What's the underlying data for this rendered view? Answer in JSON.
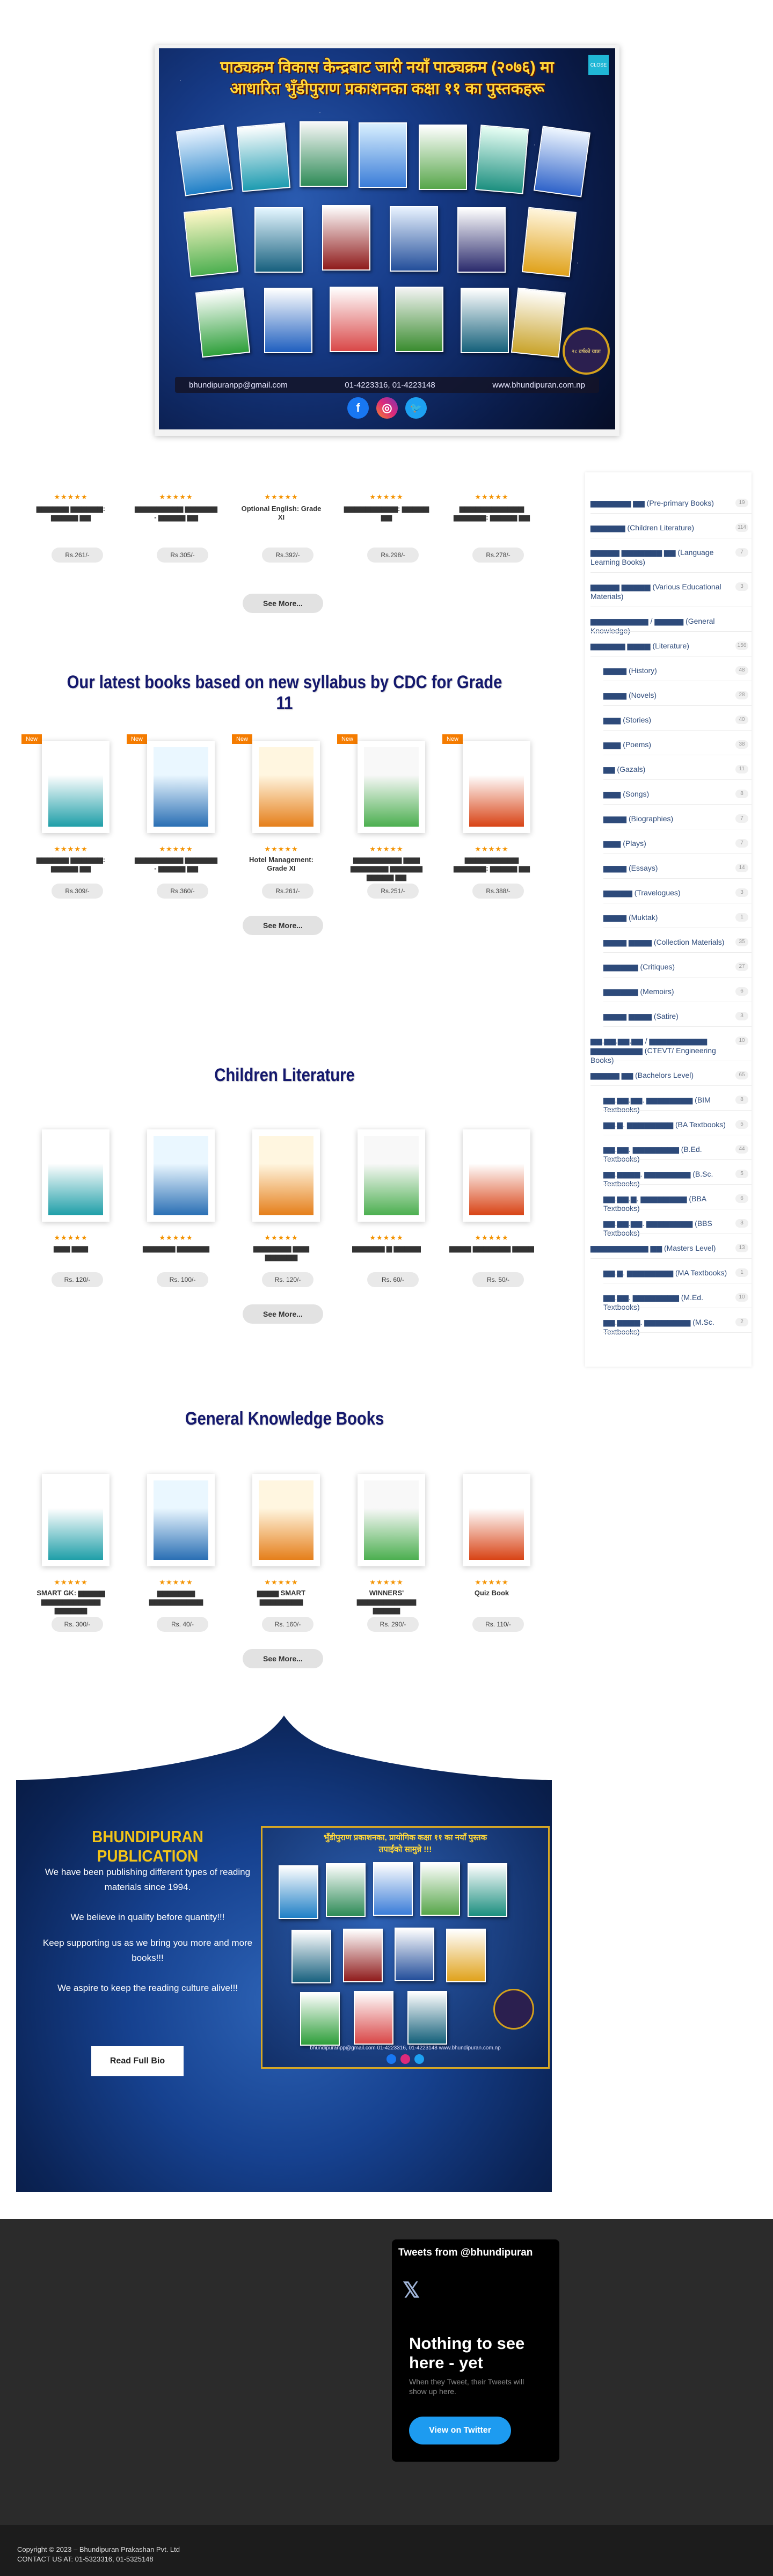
{
  "banner": {
    "title_line1": "पाठ्यक्रम विकास केन्द्रबाट जारी नयाँ पाठ्यक्रम (२०७६) मा",
    "title_line2": "आधारित भुँडीपुराण प्रकाशनका कक्षा ११ का पुस्तकहरू",
    "close_label": "CLOSE",
    "email": "bhundipuranpp@gmail.com",
    "phone": "01-4223316, 01-4223148",
    "website": "www.bhundipuran.com.np",
    "badge_text": "२८ वर्षको यात्रा",
    "social": [
      "f",
      "◎",
      "🐦"
    ]
  },
  "grid_row1": {
    "items": [
      {
        "title": "▆▆▆▆▆▆ ▆▆▆▆▆▆: ▆▆▆▆▆ ▆▆",
        "price": "Rs.261/-"
      },
      {
        "title": "▆▆▆▆▆▆▆▆▆ ▆▆▆▆▆▆ - ▆▆▆▆▆ ▆▆",
        "price": "Rs.305/-"
      },
      {
        "title": "Optional English: Grade XI",
        "price": "Rs.392/-"
      },
      {
        "title": "▆▆▆▆▆▆▆▆▆▆: ▆▆▆▆▆ ▆▆",
        "price": "Rs.298/-"
      },
      {
        "title": "▆▆▆▆▆▆▆▆▆▆▆▆ ▆▆▆▆▆▆: ▆▆▆▆▆ ▆▆",
        "price": "Rs.278/-"
      }
    ],
    "see_more": "See More..."
  },
  "section_grade11": {
    "title": "Our latest books based on new syllabus by CDC for Grade 11",
    "new_label": "New",
    "items": [
      {
        "title": "▆▆▆▆▆▆ ▆▆▆▆▆▆: ▆▆▆▆▆ ▆▆",
        "price": "Rs.309/-"
      },
      {
        "title": "▆▆▆▆▆▆▆▆▆ ▆▆▆▆▆▆ - ▆▆▆▆▆ ▆▆",
        "price": "Rs.360/-"
      },
      {
        "title": "Hotel Management: Grade XI",
        "price": "Rs.261/-"
      },
      {
        "title": "▆▆▆▆▆▆▆▆▆ ▆▆▆ ▆▆▆▆▆▆▆ ▆▆▆▆▆▆ ▆▆▆▆▆ ▆▆",
        "price": "Rs.251/-"
      },
      {
        "title": "▆▆▆▆▆▆▆▆▆▆ ▆▆▆▆▆▆: ▆▆▆▆▆ ▆▆",
        "price": "Rs.388/-"
      }
    ],
    "see_more": "See More..."
  },
  "section_children": {
    "title": "Children Literature",
    "items": [
      {
        "title": "▆▆▆ ▆▆▆",
        "price": "Rs. 120/-"
      },
      {
        "title": "▆▆▆▆▆▆ ▆▆▆▆▆▆",
        "price": "Rs. 100/-"
      },
      {
        "title": "▆▆▆▆▆▆▆ ▆▆▆ ▆▆▆▆▆▆",
        "price": "Rs. 120/-"
      },
      {
        "title": "▆▆▆▆▆▆ ▆ ▆▆▆▆▆",
        "price": "Rs. 60/-"
      },
      {
        "title": "▆▆▆▆ ▆▆▆▆▆▆▆ ▆▆▆▆",
        "price": "Rs. 50/-"
      }
    ],
    "see_more": "See More..."
  },
  "section_gk": {
    "title": "General Knowledge Books",
    "items": [
      {
        "title": "SMART GK: ▆▆▆▆▆ ▆▆▆▆▆▆▆▆▆▆▆ ▆▆▆▆▆▆",
        "price": "Rs. 300/-"
      },
      {
        "title": "▆▆▆▆▆▆▆ ▆▆▆▆▆▆▆▆▆▆",
        "price": "Rs. 40/-"
      },
      {
        "title": "▆▆▆▆ SMART ▆▆▆▆▆▆▆▆",
        "price": "Rs. 160/-"
      },
      {
        "title": "WINNERS' ▆▆▆▆▆▆▆▆▆▆▆ ▆▆▆▆▆",
        "price": "Rs. 290/-"
      },
      {
        "title": "Quiz Book",
        "price": "Rs. 110/-"
      }
    ],
    "see_more": "See More..."
  },
  "sidebar": {
    "categories": [
      {
        "name": "▆▆▆▆▆▆▆ ▆▆ (Pre-primary Books)",
        "count": "19",
        "indent": 0
      },
      {
        "name": "▆▆▆▆▆▆ (Children Literature)",
        "count": "114",
        "indent": 0
      },
      {
        "name": "▆▆▆▆▆ ▆▆▆▆▆▆▆ ▆▆ (Language Learning Books)",
        "count": "7",
        "indent": 0
      },
      {
        "name": "▆▆▆▆▆ ▆▆▆▆▆ (Various Educational Materials)",
        "count": "3",
        "indent": 0
      },
      {
        "name": "▆▆▆▆▆▆▆▆▆▆ / ▆▆▆▆▆ (General Knowledge)",
        "count": "",
        "indent": 0
      },
      {
        "name": "▆▆▆▆▆▆ ▆▆▆▆ (Literature)",
        "count": "156",
        "indent": 0
      },
      {
        "name": "▆▆▆▆ (History)",
        "count": "48",
        "indent": 1
      },
      {
        "name": "▆▆▆▆ (Novels)",
        "count": "28",
        "indent": 1
      },
      {
        "name": "▆▆▆ (Stories)",
        "count": "40",
        "indent": 1
      },
      {
        "name": "▆▆▆ (Poems)",
        "count": "38",
        "indent": 1
      },
      {
        "name": "▆▆ (Gazals)",
        "count": "11",
        "indent": 1
      },
      {
        "name": "▆▆▆ (Songs)",
        "count": "8",
        "indent": 1
      },
      {
        "name": "▆▆▆▆ (Biographies)",
        "count": "7",
        "indent": 1
      },
      {
        "name": "▆▆▆ (Plays)",
        "count": "7",
        "indent": 1
      },
      {
        "name": "▆▆▆▆ (Essays)",
        "count": "14",
        "indent": 1
      },
      {
        "name": "▆▆▆▆▆ (Travelogues)",
        "count": "3",
        "indent": 1
      },
      {
        "name": "▆▆▆▆ (Muktak)",
        "count": "1",
        "indent": 1
      },
      {
        "name": "▆▆▆▆ ▆▆▆▆ (Collection Materials)",
        "count": "35",
        "indent": 1
      },
      {
        "name": "▆▆▆▆▆▆ (Critiques)",
        "count": "27",
        "indent": 1
      },
      {
        "name": "▆▆▆▆▆▆ (Memoirs)",
        "count": "6",
        "indent": 1
      },
      {
        "name": "▆▆▆▆ ▆▆▆▆ (Satire)",
        "count": "3",
        "indent": 1
      },
      {
        "name": "▆▆.▆▆.▆▆.▆▆ / ▆▆▆▆▆▆▆▆▆▆ ▆▆▆▆▆▆▆▆▆ (CTEVT/ Engineering Books)",
        "count": "10",
        "indent": 0
      },
      {
        "name": "▆▆▆▆▆ ▆▆ (Bachelors Level)",
        "count": "65",
        "indent": 0
      },
      {
        "name": "▆▆.▆▆.▆▆. ▆▆▆▆▆▆▆▆ (BIM Textbooks)",
        "count": "8",
        "indent": 1
      },
      {
        "name": "▆▆.▆. ▆▆▆▆▆▆▆▆ (BA Textbooks)",
        "count": "5",
        "indent": 1
      },
      {
        "name": "▆▆.▆▆. ▆▆▆▆▆▆▆▆ (B.Ed. Textbooks)",
        "count": "44",
        "indent": 1
      },
      {
        "name": "▆▆.▆▆▆▆. ▆▆▆▆▆▆▆▆ (B.Sc. Textbooks)",
        "count": "5",
        "indent": 1
      },
      {
        "name": "▆▆.▆▆.▆. ▆▆▆▆▆▆▆▆ (BBA Textbooks)",
        "count": "6",
        "indent": 1
      },
      {
        "name": "▆▆.▆▆.▆▆. ▆▆▆▆▆▆▆▆ (BBS Textbooks)",
        "count": "3",
        "indent": 1
      },
      {
        "name": "▆▆▆▆▆▆▆▆▆▆ ▆▆ (Masters Level)",
        "count": "13",
        "indent": 0
      },
      {
        "name": "▆▆.▆. ▆▆▆▆▆▆▆▆ (MA Textbooks)",
        "count": "1",
        "indent": 1
      },
      {
        "name": "▆▆.▆▆. ▆▆▆▆▆▆▆▆ (M.Ed. Textbooks)",
        "count": "10",
        "indent": 1
      },
      {
        "name": "▆▆.▆▆▆▆. ▆▆▆▆▆▆▆▆ (M.Sc. Textbooks)",
        "count": "2",
        "indent": 1
      }
    ]
  },
  "promo": {
    "heading": "BHUNDIPURAN PUBLICATION",
    "p1": "We have been publishing different types of reading materials since 1994.",
    "p2": "We believe in quality before quantity!!!",
    "p3": "Keep supporting us as we bring you more and more books!!!",
    "p4": "We aspire to keep the reading culture alive!!!",
    "read_bio": "Read Full Bio",
    "image_title_line1": "भुँडीपुराण प्रकाशनका, प्रायोगिक कक्षा ११ का नयाँ पुस्तक",
    "image_title_line2": "तपाईंको सामुन्ने !!!",
    "image_footer": "bhundipuranpp@gmail.com   01-4223316, 01-4223148   www.bhundipuran.com.np"
  },
  "twitter": {
    "header": "Tweets from @bhundipuran",
    "x_logo": "𝕏",
    "headline": "Nothing to see here - yet",
    "subtext": "When they Tweet, their Tweets will show up here.",
    "button": "View on Twitter"
  },
  "footer": {
    "copyright": "Copyright © 2023 – Bhundipuran Prakashan Pvt. Ltd",
    "contact": "CONTACT US AT: 01-5323316, 01-5325148"
  },
  "colors": {
    "accent_orange": "#f57c00",
    "title_navy": "#14186d",
    "star_orange": "#f39200",
    "gold": "#f2c417",
    "twitter_blue": "#1d9bf0"
  },
  "ratings_stars": "★★★★★"
}
